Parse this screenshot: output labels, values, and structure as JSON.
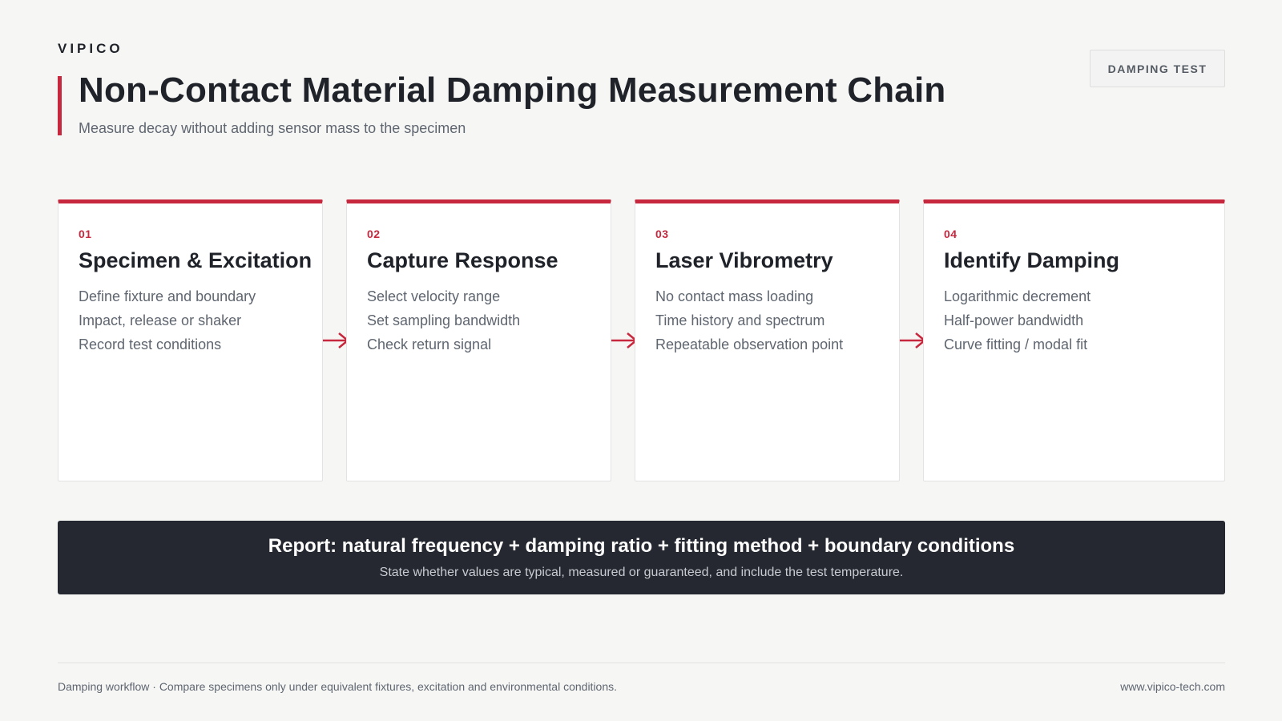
{
  "brand": "VIPICO",
  "header": {
    "title": "Non-Contact Material Damping Measurement Chain",
    "subtitle": "Measure decay without adding sensor mass to the specimen",
    "tag": "DAMPING TEST"
  },
  "steps": [
    {
      "num": "01",
      "title": "Specimen & Excitation",
      "items": [
        "Define fixture and boundary",
        "Impact, release or shaker",
        "Record test conditions"
      ]
    },
    {
      "num": "02",
      "title": "Capture Response",
      "items": [
        "Select velocity range",
        "Set sampling bandwidth",
        "Check return signal"
      ]
    },
    {
      "num": "03",
      "title": "Laser Vibrometry",
      "items": [
        "No contact mass loading",
        "Time history and spectrum",
        "Repeatable observation point"
      ]
    },
    {
      "num": "04",
      "title": "Identify Damping",
      "items": [
        "Logarithmic decrement",
        "Half-power bandwidth",
        "Curve fitting / modal fit"
      ]
    }
  ],
  "report": {
    "title": "Report: natural frequency + damping ratio + fitting method + boundary conditions",
    "subtitle": "State whether values are typical, measured or guaranteed, and include the test temperature."
  },
  "footer": {
    "left": "Damping workflow · Compare specimens only under equivalent fixtures, excitation and environmental conditions.",
    "right": "www.vipico-tech.com"
  },
  "colors": {
    "accent": "#c8283e",
    "dark_panel": "#252830",
    "background": "#f6f6f5"
  }
}
